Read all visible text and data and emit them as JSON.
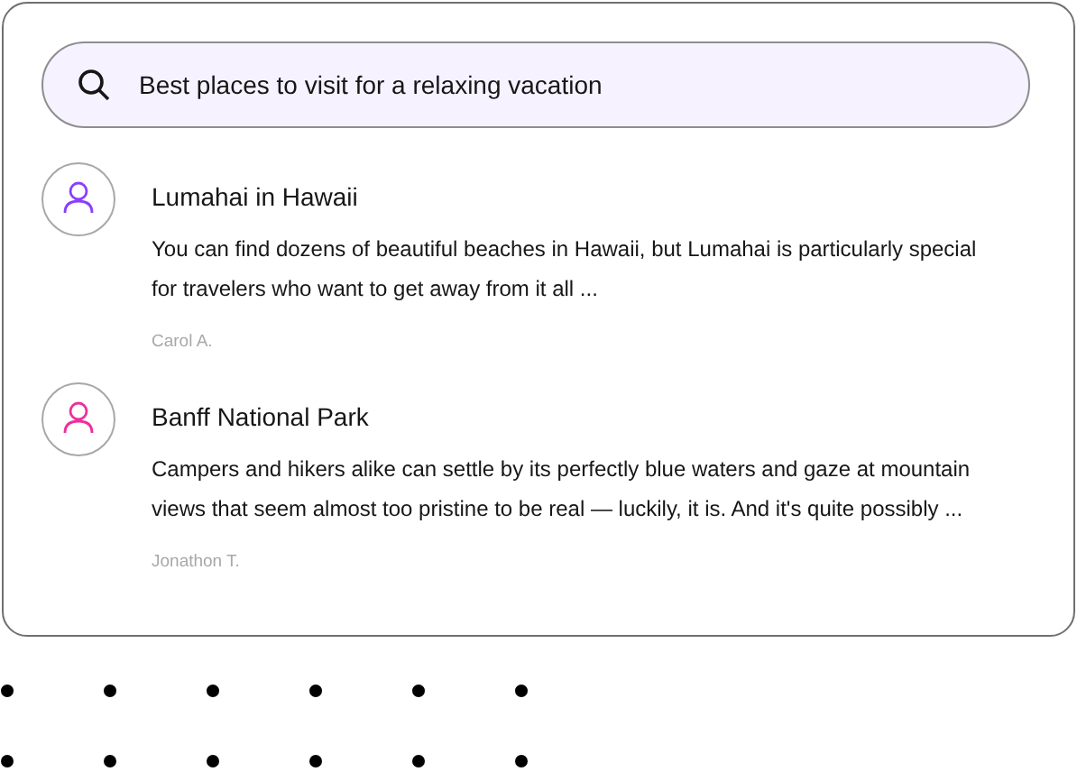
{
  "search": {
    "value": "Best places to visit for a relaxing vacation"
  },
  "results": [
    {
      "title": "Lumahai in Hawaii",
      "snippet": "You can find dozens of beautiful beaches in Hawaii, but Lumahai is particularly special for travelers who want to get away from it all ...",
      "author": "Carol A.",
      "color": "#8a3ffc"
    },
    {
      "title": "Banff National Park",
      "snippet": "Campers and hikers alike can settle by its perfectly blue waters and gaze at mountain views that seem almost too pristine to be real — luckily, it is. And it's quite possibly ...",
      "author": "Jonathon T.",
      "color": "#ee2f9c"
    }
  ]
}
